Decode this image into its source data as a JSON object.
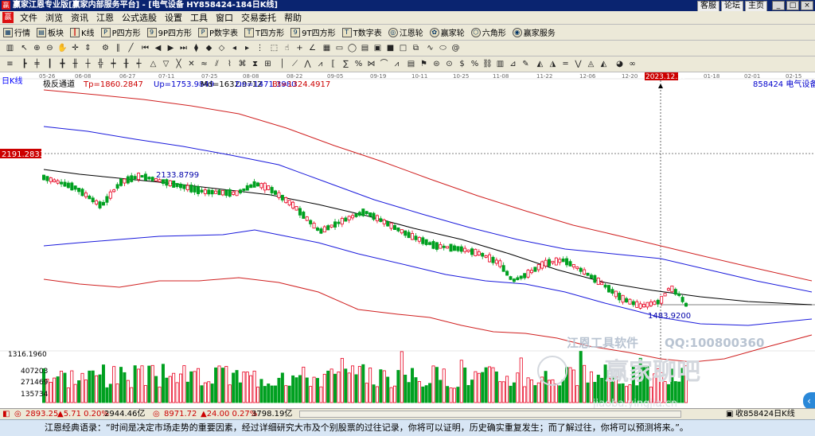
{
  "window": {
    "title": "赢家江恩专业版[赢家内部服务平台] - [电气设备  HY858424-184日K线]",
    "links": [
      "客服",
      "论坛",
      "主页"
    ]
  },
  "menu": [
    "文件",
    "浏览",
    "资讯",
    "江恩",
    "公式选股",
    "设置",
    "工具",
    "窗口",
    "交易委托",
    "帮助"
  ],
  "toolbar1": [
    {
      "label": "行情",
      "icon": "quote-grid-icon"
    },
    {
      "label": "板块",
      "icon": "sector-icon"
    },
    {
      "label": "K线",
      "icon": "kline-icon"
    },
    {
      "label": "P四方形",
      "icon": "p-square-icon"
    },
    {
      "label": "9P四方形",
      "icon": "9p-square-icon"
    },
    {
      "label": "P数字表",
      "icon": "p-table-icon"
    },
    {
      "label": "T四方形",
      "icon": "t-square-icon"
    },
    {
      "label": "9T四方形",
      "icon": "9t-square-icon"
    },
    {
      "label": "T数字表",
      "icon": "t-table-icon"
    },
    {
      "label": "江恩轮",
      "icon": "gann-wheel-icon"
    },
    {
      "label": "赢家轮",
      "icon": "winner-wheel-icon"
    },
    {
      "label": "六角形",
      "icon": "hexagon-icon"
    },
    {
      "label": "赢家服务",
      "icon": "service-icon"
    }
  ],
  "chart": {
    "period_label": "日K线",
    "indicator": {
      "name": "极反通道",
      "tp": "Tp=1860.2847",
      "up": "Up=1753.9849",
      "md": "Md=1632.9712",
      "dn": "Dn=1471.3980",
      "bt": "Bt=1324.4917"
    },
    "code_label": "858424 电气设备",
    "price_marker": "2191.2833",
    "date_highlight": "2023.12.29",
    "high_label": "2133.8799",
    "low_label": "1483.9200",
    "volume_ticks": [
      "1316.1960",
      "407203",
      "271469",
      "135734"
    ],
    "watermark_tools": "江恩工具软件",
    "watermark_qq": "QQ:100800360",
    "watermark_site": "赢家聊吧",
    "watermark_url": "jiaoba.yingjia.cn",
    "date_ticks": [
      "05-26",
      "06-08",
      "06-27",
      "07-11",
      "07-25",
      "08-08",
      "08-22",
      "09-05",
      "09-19",
      "10-11",
      "10-25",
      "11-08",
      "11-22",
      "12-06",
      "12-20",
      "01-18",
      "02-01",
      "02-15"
    ],
    "colors": {
      "up": "#e8001f",
      "down": "#00a020",
      "upper_band": "#d02020",
      "mid_band": "#1a1adc",
      "centre": "#000000"
    }
  },
  "chart_data": {
    "type": "candlestick",
    "y_axis_marker": 2191.2833,
    "indicator_values": {
      "Tp": 1860.2847,
      "Up": 1753.9849,
      "Md": 1632.9712,
      "Dn": 1471.398,
      "Bt": 1324.4917
    },
    "high_annotation": 2133.8799,
    "low_annotation": 1483.92
  },
  "status": {
    "idx1": "2893.25",
    "idx1_chg": "▲5.71 0.20%",
    "idx1_amt": "2944.46亿",
    "idx2": "8971.72",
    "idx2_chg": "▲24.00 0.27%",
    "idx2_amt": "3798.19亿",
    "right_label": "收858424日K线"
  },
  "quote": "江恩经典语录：“时间是决定市场走势的重要因素，经过详细研究大市及个别股票的过往记录，你将可以证明，历史确实重复发生；而了解过往，你将可以预测将来。”。"
}
